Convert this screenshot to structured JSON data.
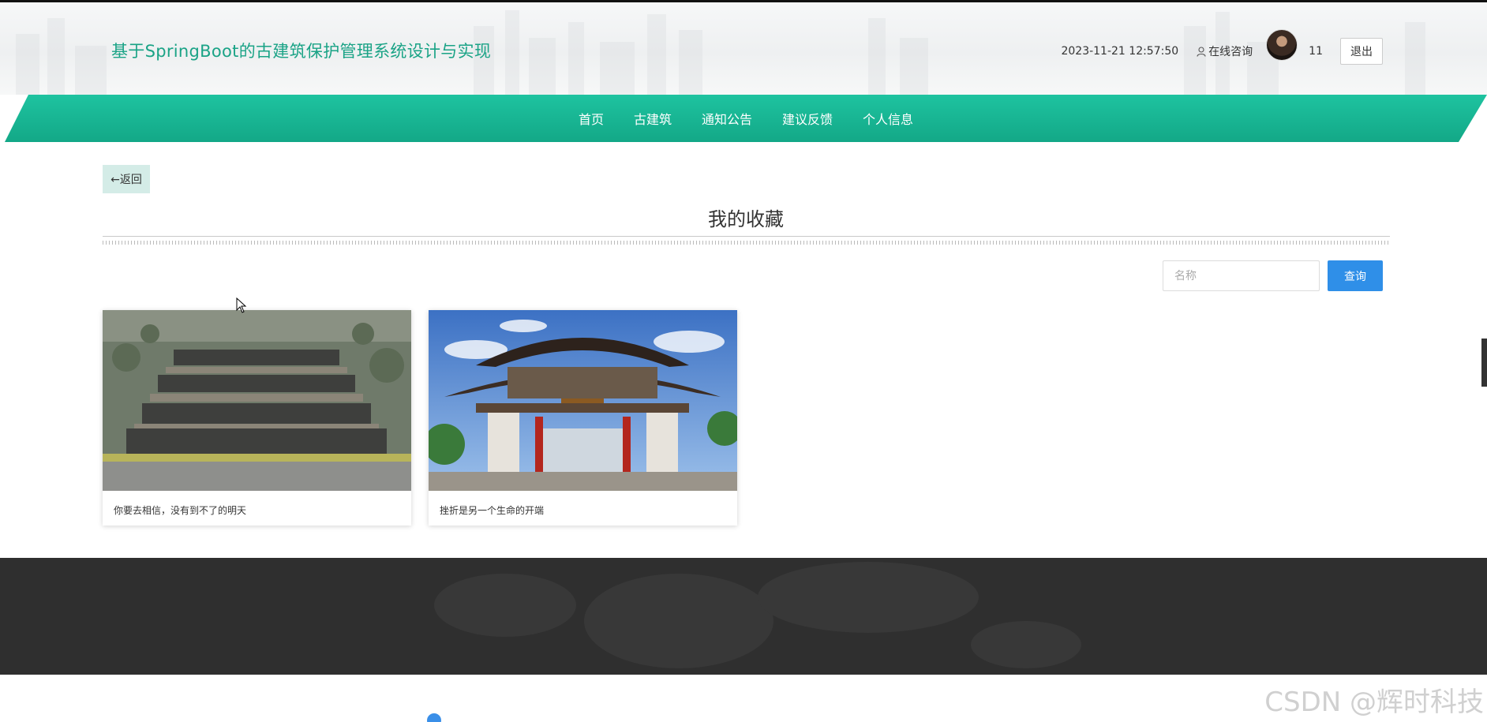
{
  "header": {
    "title": "基于SpringBoot的古建筑保护管理系统设计与实现",
    "datetime": "2023-11-21 12:57:50",
    "consult_label": "在线咨询",
    "username": "11",
    "logout_label": "退出"
  },
  "nav": {
    "items": [
      {
        "label": "首页"
      },
      {
        "label": "古建筑"
      },
      {
        "label": "通知公告"
      },
      {
        "label": "建议反馈"
      },
      {
        "label": "个人信息"
      }
    ]
  },
  "back_label": "←返回",
  "page_title": "我的收藏",
  "search": {
    "placeholder": "名称",
    "value": "",
    "button_label": "查询"
  },
  "cards": [
    {
      "caption": "你要去相信，没有到不了的明天",
      "image": "ancient-courtyard-aerial"
    },
    {
      "caption": "挫折是另一个生命的开端",
      "image": "pagoda-gate-arch"
    }
  ],
  "watermark": "CSDN @辉时科技",
  "colors": {
    "accent": "#1aa386",
    "nav_green": "#19b996",
    "search_button": "#2f8fe8",
    "back_button": "#d4ece7",
    "footer": "#2f2f2f"
  }
}
